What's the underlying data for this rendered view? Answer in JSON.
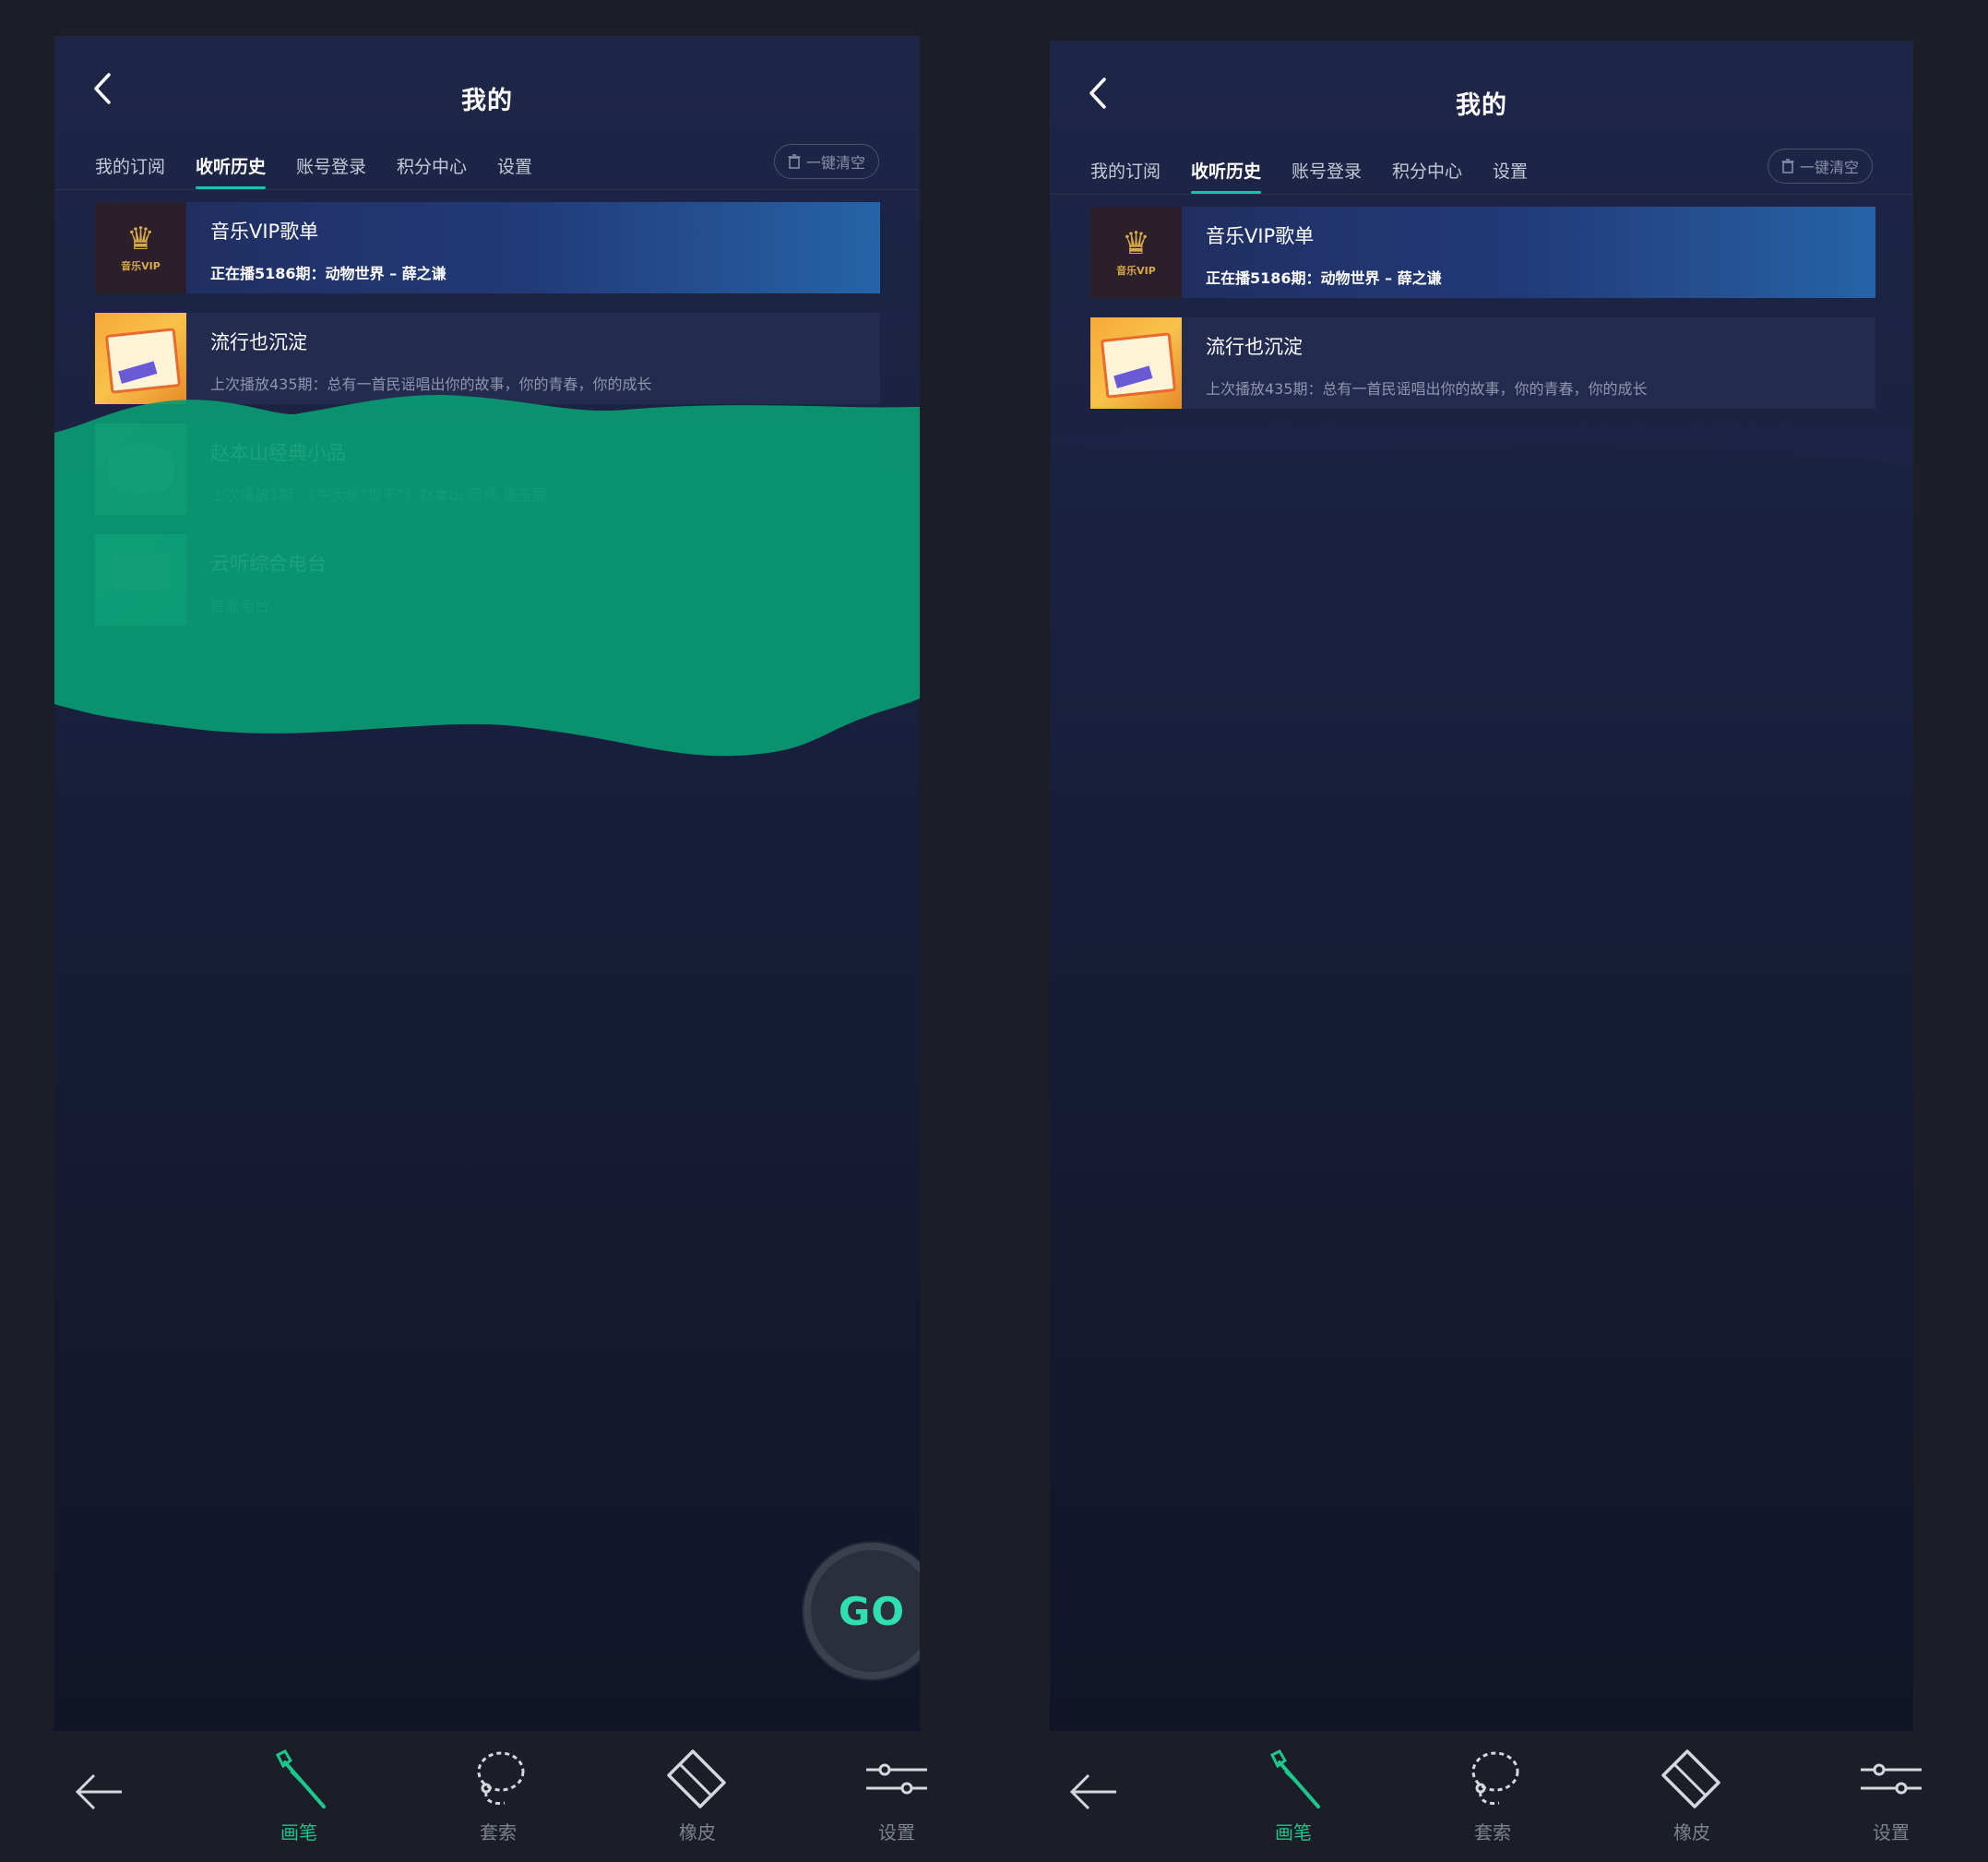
{
  "panels": [
    {
      "title": "我的",
      "tabs": [
        "我的订阅",
        "收听历史",
        "账号登录",
        "积分中心",
        "设置"
      ],
      "active_tab": 1,
      "clear_label": "一键清空",
      "items": [
        {
          "title": "音乐VIP歌单",
          "subtitle": "正在播5186期：动物世界 – 薛之谦",
          "thumb_label": "音乐VIP",
          "playing": true
        },
        {
          "title": "流行也沉淀",
          "subtitle": "上次播放435期：总有一首民谣唱出你的故事，你的青春，你的成长",
          "playing": false
        },
        {
          "title": "赵本山经典小品",
          "subtitle": "上次播放1期：《牛大叔“提干”》赵本山 范伟 张玉屏",
          "playing": false
        },
        {
          "title": "云听综合电台",
          "subtitle": "智能电台",
          "playing": false
        }
      ],
      "go_label": "GO",
      "paint_color": "#0a9a72"
    },
    {
      "title": "我的",
      "tabs": [
        "我的订阅",
        "收听历史",
        "账号登录",
        "积分中心",
        "设置"
      ],
      "active_tab": 1,
      "clear_label": "一键清空",
      "items": [
        {
          "title": "音乐VIP歌单",
          "subtitle": "正在播5186期：动物世界 – 薛之谦",
          "thumb_label": "音乐VIP",
          "playing": true
        },
        {
          "title": "流行也沉淀",
          "subtitle": "上次播放435期：总有一首民谣唱出你的故事，你的青春，你的成长",
          "playing": false
        }
      ]
    }
  ],
  "toolbar": {
    "tools": [
      {
        "label": "",
        "icon": "back-arrow-icon"
      },
      {
        "label": "画笔",
        "icon": "brush-icon",
        "active": true
      },
      {
        "label": "套索",
        "icon": "lasso-icon"
      },
      {
        "label": "橡皮",
        "icon": "eraser-icon"
      },
      {
        "label": "设置",
        "icon": "sliders-icon"
      }
    ]
  },
  "colors": {
    "accent": "#1ec68e",
    "tab_underline": "#18c3b3",
    "go_text": "#2ee0b0"
  }
}
